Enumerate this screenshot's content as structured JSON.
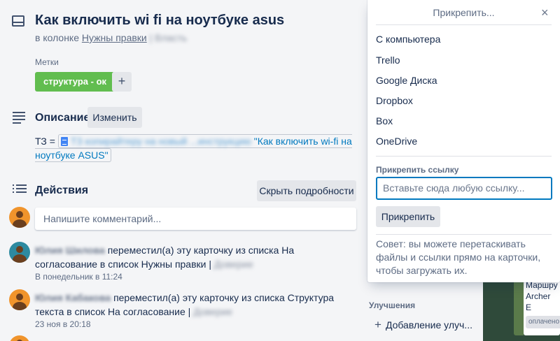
{
  "card": {
    "title": "Как включить wi fi на ноутбуке asus",
    "in_column_prefix": "в колонке",
    "column_name": "Нужны правки",
    "column_extra": "| Власть"
  },
  "labels": {
    "heading": "Метки",
    "items": [
      {
        "text": "структура - ок",
        "color": "#61bd4f"
      }
    ],
    "add_symbol": "+"
  },
  "description": {
    "title": "Описание",
    "edit_label": "Изменить",
    "prefix": "ТЗ =",
    "link_blurred": "ТЗ копирайтеру на новый ...инструкцию",
    "link_text": "\"Как включить wi-fi на ноутбуке ASUS\""
  },
  "actions": {
    "title": "Действия",
    "hide_details_label": "Скрыть подробности",
    "comment_placeholder": "Напишите комментарий...",
    "items": [
      {
        "user": "Юлия Шилова",
        "text": "переместил(а) эту карточку из списка На согласование в список Нужны правки |",
        "text_extra": "Доверие",
        "time": "В понедельник в 11:24"
      },
      {
        "user": "Юлия Кабакова",
        "text": "переместил(а) эту карточку из списка Структура текста в список На согласование |",
        "text_extra": "Доверие",
        "time": "23 ноя в 20:18"
      }
    ]
  },
  "sidebar": {
    "improvements_heading": "Улучшения",
    "add_improvement": "Добавление улуч..."
  },
  "attach_popover": {
    "title": "Прикрепить...",
    "close_symbol": "×",
    "sources": [
      "С компьютера",
      "Trello",
      "Google Диска",
      "Dropbox",
      "Box",
      "OneDrive"
    ],
    "link_label": "Прикрепить ссылку",
    "link_placeholder": "Вставьте сюда любую ссылку...",
    "attach_button": "Прикрепить",
    "tip": "Совет: вы можете перетаскивать файлы и ссылки прямо на карточки, чтобы загружать их."
  },
  "board_card": {
    "text": "Маршру Archer E",
    "tag": "оплачено"
  },
  "colors": {
    "accent": "#0079bf",
    "label_green": "#61bd4f",
    "modal_bg": "#f4f5f7"
  }
}
